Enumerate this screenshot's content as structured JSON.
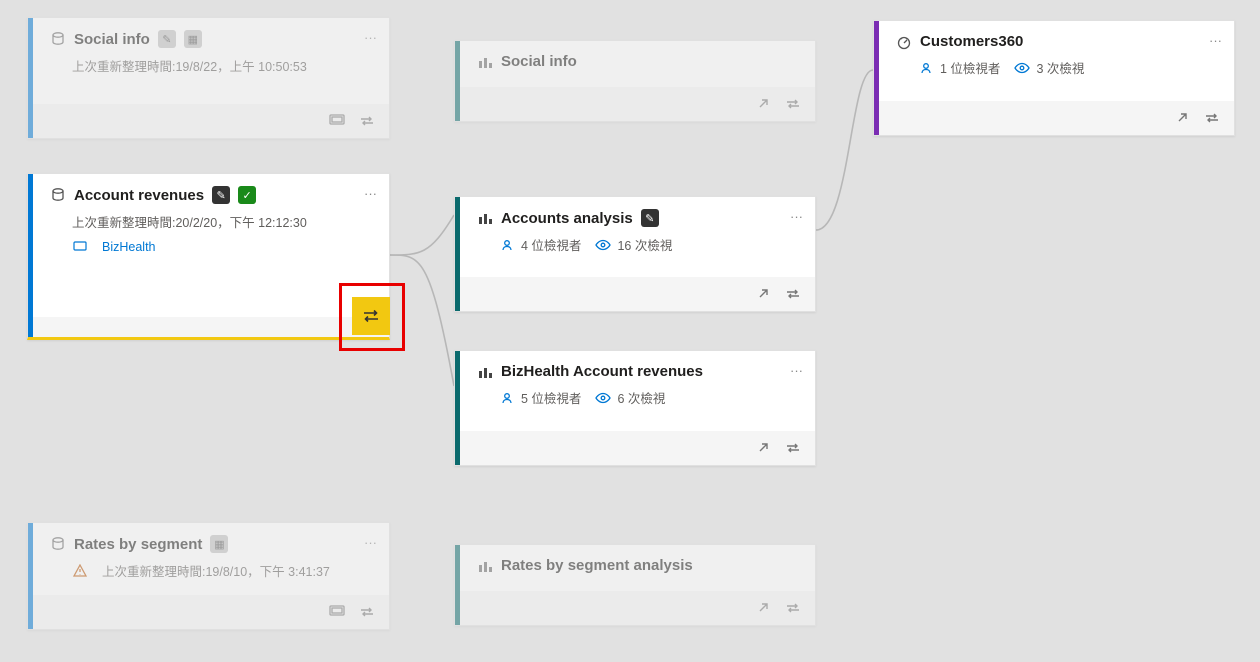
{
  "colors": {
    "blue": "#0078d4",
    "teal": "#0b6a6d",
    "purple": "#7b2db3",
    "yellow": "#f2c811"
  },
  "cards": {
    "social_ds": {
      "title": "Social info",
      "refresh": "上次重新整理時間:19/8/22，上午 10:50:53"
    },
    "account_ds": {
      "title": "Account revenues",
      "refresh": "上次重新整理時間:20/2/20，下午 12:12:30",
      "workspace": "BizHealth"
    },
    "rates_ds": {
      "title": "Rates by segment",
      "refresh": "上次重新整理時間:19/8/10，下午 3:41:37"
    },
    "social_rpt": {
      "title": "Social info"
    },
    "accounts_rpt": {
      "title": "Accounts analysis",
      "viewers": "4 位檢視者",
      "views": "16 次檢視"
    },
    "bizhealth_rpt": {
      "title": "BizHealth Account revenues",
      "viewers": "5 位檢視者",
      "views": "6 次檢視"
    },
    "rates_rpt": {
      "title": "Rates by segment analysis"
    },
    "customers_rpt": {
      "title": "Customers360",
      "viewers": "1 位檢視者",
      "views": "3 次檢視"
    }
  }
}
